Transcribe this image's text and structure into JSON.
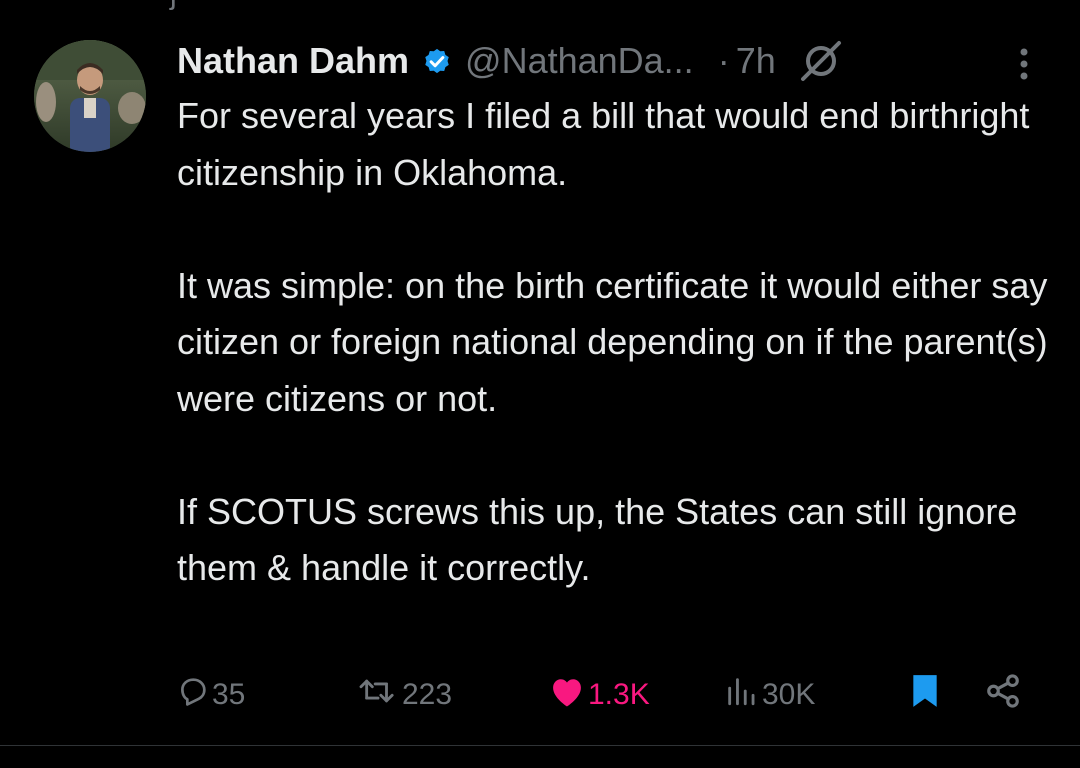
{
  "colors": {
    "background": "#000000",
    "primary_text": "#e7e9ea",
    "secondary_text": "#71767b",
    "verified_blue": "#1d9bf0",
    "like_pink": "#f91880",
    "bookmark_blue": "#1d9bf0",
    "divider": "#2f3336"
  },
  "tweet": {
    "author": {
      "name": "Nathan Dahm",
      "handle": "@NathanDa...",
      "verified": true,
      "avatar_icon": "avatar-photo"
    },
    "dot": "·",
    "time": "7h",
    "body": [
      "For several years I filed a bill that would end birthright citizenship in Oklahoma.",
      "It was simple: on the birth certificate it would either say citizen or foreign national depending on if the parent(s) were citizens or not.",
      "If SCOTUS screws this up, the States can still ignore them & handle it correctly."
    ],
    "actions": {
      "replies": "35",
      "reposts": "223",
      "likes": "1.3K",
      "views": "30K",
      "bookmarked": true
    }
  }
}
